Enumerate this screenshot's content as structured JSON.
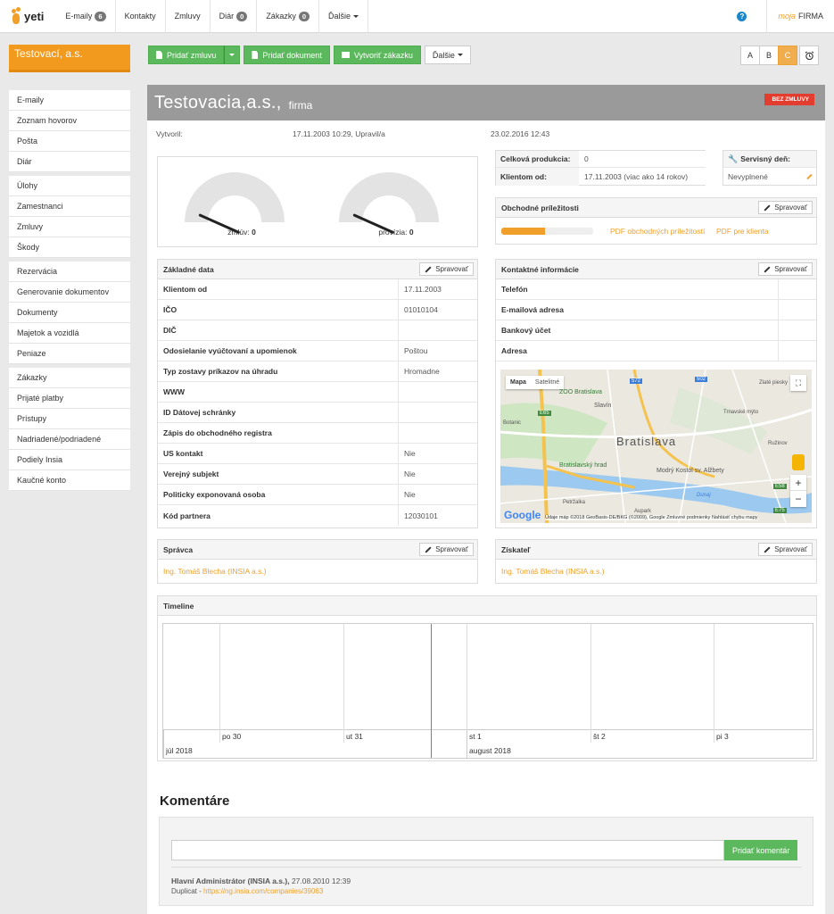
{
  "topnav": {
    "logo": "yeti",
    "items": [
      {
        "label": "E-maily",
        "badge": "6"
      },
      {
        "label": "Kontakty"
      },
      {
        "label": "Zmluvy"
      },
      {
        "label": "Diár",
        "badge": "0"
      },
      {
        "label": "Zákazky",
        "badge": "0"
      },
      {
        "label": "Ďalšie"
      }
    ],
    "help": "?",
    "moja": "moja",
    "firma": "FIRMA"
  },
  "sidebar": {
    "title": "Testovací, a.s.",
    "groups": [
      [
        "E-maily",
        "Zoznam hovorov",
        "Pošta",
        "Diár"
      ],
      [
        "Úlohy",
        "Zamestnanci",
        "Zmluvy",
        "Škody"
      ],
      [
        "Rezervácia",
        "Generovanie dokumentov",
        "Dokumenty",
        "Majetok a vozidlá",
        "Peniaze"
      ],
      [
        "Zákazky",
        "Prijaté platby",
        "Prístupy",
        "Nadriadené/podriadené",
        "Podiely Insia",
        "Kaučné konto"
      ]
    ]
  },
  "toolbar": {
    "add_contract": "Pridať zmluvu",
    "add_document": "Pridať dokument",
    "create_order": "Vytvoriť zákazku",
    "more": "Ďalšie",
    "ratings": [
      "A",
      "B",
      "C"
    ],
    "active_rating": "C"
  },
  "company": {
    "name": "Testovacia,a.s.,",
    "type": "firma",
    "tag": "BEZ ZMLUVY",
    "created_label": "Vytvoril:",
    "created": "17.11.2003 10:29, Upravil/a",
    "updated": "23.02.2016 12:43"
  },
  "gauges": [
    {
      "label": "zmlúv:",
      "value": "0"
    },
    {
      "label": "provízia:",
      "value": "0"
    }
  ],
  "production": {
    "total_label": "Celková produkcia:",
    "total": "0",
    "client_since_label": "Klientom od:",
    "client_since": "17.11.2003 (viac ako 14 rokov)"
  },
  "service_day": {
    "label": "Servisný deň:",
    "value": "Nevyplnené"
  },
  "opportunities": {
    "title": "Obchodné príležitosti",
    "manage": "Spravovať",
    "progress": 0.48,
    "pdf_opps": "PDF obchodných príležitostí",
    "pdf_client": "PDF pre klienta"
  },
  "basic": {
    "title": "Základné data",
    "manage": "Spravovať",
    "rows": [
      {
        "k": "Klientom od",
        "v": "17.11.2003"
      },
      {
        "k": "IČO",
        "v": "01010104"
      },
      {
        "k": "DIČ",
        "v": ""
      },
      {
        "k": "Odosielanie vyúčtovaní a upomienok",
        "v": "Poštou"
      },
      {
        "k": "Typ zostavy príkazov na úhradu",
        "v": "Hromadne"
      },
      {
        "k": "WWW",
        "v": ""
      },
      {
        "k": "ID Dátovej schránky",
        "v": ""
      },
      {
        "k": "Zápis do obchodného registra",
        "v": ""
      },
      {
        "k": "US kontakt",
        "v": "Nie"
      },
      {
        "k": "Verejný subjekt",
        "v": "Nie"
      },
      {
        "k": "Politicky exponovaná osoba",
        "v": "Nie"
      },
      {
        "k": "Kód partnera",
        "v": "12030101"
      }
    ]
  },
  "contact": {
    "title": "Kontaktné informácie",
    "manage": "Spravovať",
    "rows": [
      "Telefón",
      "E-mailová adresa",
      "Bankový účet",
      "Adresa"
    ]
  },
  "map": {
    "tab_map": "Mapa",
    "tab_sat": "Satelitné",
    "city": "Bratislava",
    "labels": [
      "ZOO Bratislava",
      "Slavín",
      "Bratislavský hrad",
      "Modrý Kostol sv. Alžbety",
      "Aupark",
      "Dunaj",
      "Botanic",
      "Zlaté piesky",
      "Trnavské mýto",
      "Ružinov",
      "Petržalka"
    ],
    "roads": [
      "572",
      "E65",
      "502",
      "E58",
      "E75"
    ],
    "footer": "Údaje máp ©2018 GeoBasis-DE/BKG (©2009), Google   Zmluvné podmienky   Nahlásiť chybu mapy",
    "google": "Google"
  },
  "manager": {
    "title": "Správca",
    "manage": "Spravovať",
    "name": "Ing. Tomáš Blecha (INSIA a.s.)"
  },
  "acquirer": {
    "title": "Získateľ",
    "manage": "Spravovať",
    "name": "Ing. Tomáš Blecha (INSIA a.s.)"
  },
  "timeline": {
    "title": "Timeline",
    "days": [
      "po 30",
      "ut 31",
      "st 1",
      "št 2",
      "pi 3"
    ],
    "months": [
      "júl 2018",
      "august 2018"
    ]
  },
  "comments": {
    "title": "Komentáre",
    "add": "Pridať komentár",
    "author": "Hlavní Administrátor (INSIA a.s.),",
    "date": "27.08.2010 12:39",
    "dup_label": "Duplicat -",
    "dup_link": "https://ng.insia.com/companies/39063"
  }
}
